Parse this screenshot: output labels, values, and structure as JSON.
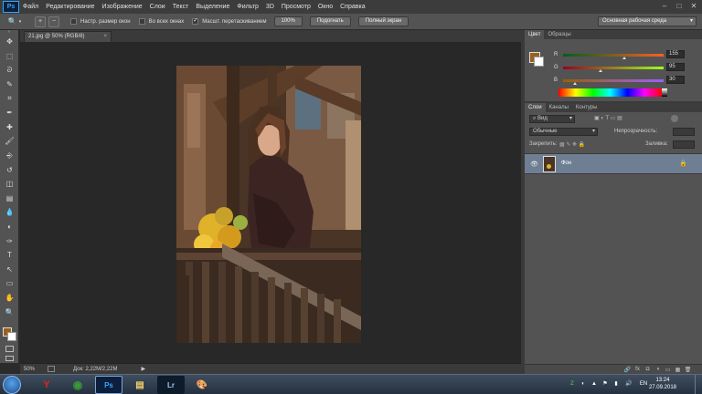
{
  "app": {
    "logo": "Ps"
  },
  "menu": [
    "Файл",
    "Редактирование",
    "Изображение",
    "Слои",
    "Текст",
    "Выделение",
    "Фильтр",
    "3D",
    "Просмотр",
    "Окно",
    "Справка"
  ],
  "window_controls": {
    "minimize": "–",
    "maximize": "□",
    "close": "✕"
  },
  "options": {
    "tool_icon": "zoom-tool-icon",
    "tool_glyph": "🔍",
    "zoom_in_glyph": "+",
    "zoom_out_glyph": "−",
    "checkbox1": {
      "label": "Настр. размер окон",
      "checked": false
    },
    "checkbox2": {
      "label": "Во всех окнах",
      "checked": false
    },
    "checkbox3": {
      "label": "Масшт. перетаскиванием",
      "checked": true
    },
    "btn_100": "100%",
    "btn_fit": "Подогнать",
    "btn_fullscreen": "Полный экран",
    "workspace": "Основная рабочая среда"
  },
  "document": {
    "tab_title": "21.jpg @ 50% (RGB/8)",
    "tab_close": "×"
  },
  "status": {
    "zoom": "50%",
    "doc_info": "Док: 2,22M/2,22M"
  },
  "color_panel": {
    "tabs": [
      "Цвет",
      "Образцы"
    ],
    "foreground": "#9b5f1e",
    "r": {
      "label": "R",
      "value": "155",
      "fraction": 0.61
    },
    "g": {
      "label": "G",
      "value": "95",
      "fraction": 0.37
    },
    "b": {
      "label": "B",
      "value": "30",
      "fraction": 0.12
    }
  },
  "layers_panel": {
    "tabs": [
      "Слои",
      "Каналы",
      "Контуры"
    ],
    "filter_kind": "Вид",
    "blend_mode": "Обычные",
    "opacity_label": "Непрозрачность:",
    "lock_label": "Закрепить:",
    "fill_label": "Заливка:",
    "layer_name": "Фон",
    "bottom_icons": [
      "🔗",
      "fx",
      "◘",
      "◑",
      "▭",
      "▦",
      "🗑"
    ]
  },
  "toolbox": {
    "tools": [
      "move-tool-icon",
      "marquee-tool-icon",
      "lasso-tool-icon",
      "quick-select-tool-icon",
      "crop-tool-icon",
      "eyedropper-tool-icon",
      "healing-brush-tool-icon",
      "brush-tool-icon",
      "clone-stamp-tool-icon",
      "history-brush-tool-icon",
      "eraser-tool-icon",
      "gradient-tool-icon",
      "blur-tool-icon",
      "dodge-tool-icon",
      "pen-tool-icon",
      "type-tool-icon",
      "path-select-tool-icon",
      "rectangle-tool-icon",
      "hand-tool-icon",
      "zoom-tool-icon"
    ],
    "glyphs": [
      "✥",
      "⬚",
      "ᘐ",
      "✎",
      "⌗",
      "✒",
      "✚",
      "🖌",
      "⎆",
      "↺",
      "◫",
      "▤",
      "💧",
      "◐",
      "✑",
      "T",
      "↖",
      "▭",
      "✋",
      "🔍"
    ]
  },
  "taskbar": {
    "apps": [
      "Y",
      "◉",
      "Ps",
      "▤",
      "Lr",
      "🎨"
    ],
    "time": "13:24",
    "date": "27.09.2018",
    "tray": [
      "Z",
      "◐",
      "▲",
      "⚑",
      "▮",
      "🔊",
      "EN"
    ]
  }
}
